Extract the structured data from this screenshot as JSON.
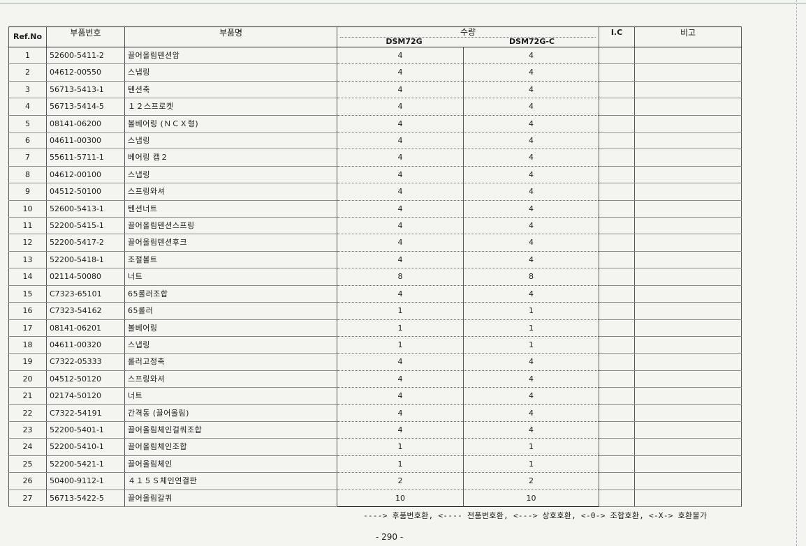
{
  "header": {
    "ref_no": "Ref.No",
    "part_number": "부품번호",
    "part_name": "부품명",
    "quantity": "수량",
    "model_a": "DSM72G",
    "model_b": "DSM72G-C",
    "ic": "I.C",
    "remarks": "비고"
  },
  "rows": [
    {
      "ref": "1",
      "partno": "52600-5411-2",
      "name": "끌어올림텐션암",
      "qa": "4",
      "qb": "4"
    },
    {
      "ref": "2",
      "partno": "04612-00550",
      "name": "스냅링",
      "qa": "4",
      "qb": "4"
    },
    {
      "ref": "3",
      "partno": "56713-5413-1",
      "name": "텐션축",
      "qa": "4",
      "qb": "4"
    },
    {
      "ref": "4",
      "partno": "56713-5414-5",
      "name": "１２스프로켓",
      "qa": "4",
      "qb": "4"
    },
    {
      "ref": "5",
      "partno": "08141-06200",
      "name": "볼베어링 (ＮＣＸ형)",
      "qa": "4",
      "qb": "4"
    },
    {
      "ref": "6",
      "partno": "04611-00300",
      "name": "스냅링",
      "qa": "4",
      "qb": "4"
    },
    {
      "ref": "7",
      "partno": "55611-5711-1",
      "name": "베어링  캡２",
      "qa": "4",
      "qb": "4"
    },
    {
      "ref": "8",
      "partno": "04612-00100",
      "name": "스냅링",
      "qa": "4",
      "qb": "4"
    },
    {
      "ref": "9",
      "partno": "04512-50100",
      "name": "스프링와셔",
      "qa": "4",
      "qb": "4"
    },
    {
      "ref": "10",
      "partno": "52600-5413-1",
      "name": "텐션너트",
      "qa": "4",
      "qb": "4"
    },
    {
      "ref": "11",
      "partno": "52200-5415-1",
      "name": "끌어올림텐션스프링",
      "qa": "4",
      "qb": "4"
    },
    {
      "ref": "12",
      "partno": "52200-5417-2",
      "name": "끌어올림텐션후크",
      "qa": "4",
      "qb": "4"
    },
    {
      "ref": "13",
      "partno": "52200-5418-1",
      "name": "조절볼트",
      "qa": "4",
      "qb": "4"
    },
    {
      "ref": "14",
      "partno": "02114-50080",
      "name": "너트",
      "qa": "8",
      "qb": "8"
    },
    {
      "ref": "15",
      "partno": "C7323-65101",
      "name": "65롤러조합",
      "qa": "4",
      "qb": "4"
    },
    {
      "ref": "16",
      "partno": "C7323-54162",
      "name": "65롤러",
      "qa": "1",
      "qb": "1"
    },
    {
      "ref": "17",
      "partno": "08141-06201",
      "name": "볼베어링",
      "qa": "1",
      "qb": "1"
    },
    {
      "ref": "18",
      "partno": "04611-00320",
      "name": "스냅링",
      "qa": "1",
      "qb": "1"
    },
    {
      "ref": "19",
      "partno": "C7322-05333",
      "name": "롤러고정축",
      "qa": "4",
      "qb": "4"
    },
    {
      "ref": "20",
      "partno": "04512-50120",
      "name": "스프링와셔",
      "qa": "4",
      "qb": "4"
    },
    {
      "ref": "21",
      "partno": "02174-50120",
      "name": "너트",
      "qa": "4",
      "qb": "4"
    },
    {
      "ref": "22",
      "partno": "C7322-54191",
      "name": "간격동 (끌어올림)",
      "qa": "4",
      "qb": "4"
    },
    {
      "ref": "23",
      "partno": "52200-5401-1",
      "name": "끌어올림체인걸쿼조합",
      "qa": "4",
      "qb": "4"
    },
    {
      "ref": "24",
      "partno": "52200-5410-1",
      "name": "끌어올림체인조합",
      "qa": "1",
      "qb": "1"
    },
    {
      "ref": "25",
      "partno": "52200-5421-1",
      "name": "끌어올림체인",
      "qa": "1",
      "qb": "1"
    },
    {
      "ref": "26",
      "partno": "50400-9112-1",
      "name": "４１５Ｓ체인연결판",
      "qa": "2",
      "qb": "2"
    },
    {
      "ref": "27",
      "partno": "56713-5422-5",
      "name": "끌어올림갈퀴",
      "qa": "10",
      "qb": "10"
    }
  ],
  "legend": "----> 후품번호환, <---- 전품번호환, <---> 상호호환, <-0-> 조합호환, <-X-> 호환불가",
  "page_number": "- 290 -"
}
